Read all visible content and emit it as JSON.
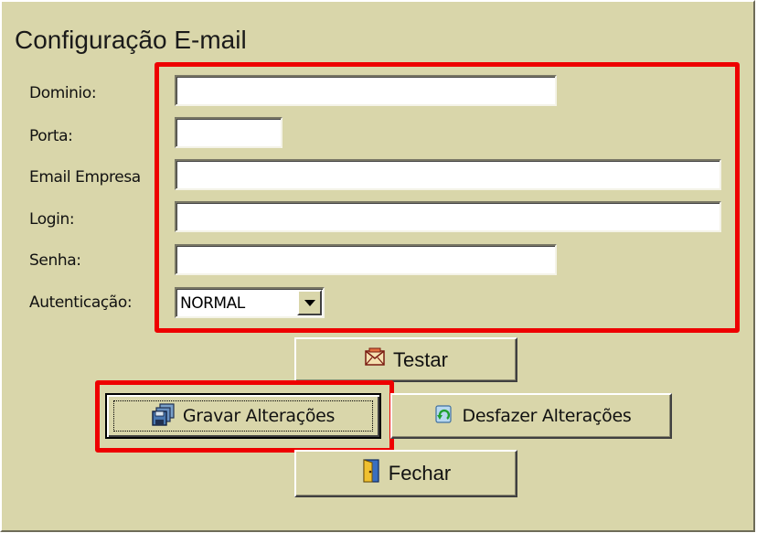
{
  "title": "Configuração E-mail",
  "fields": {
    "dominio": {
      "label": "Dominio:",
      "value": ""
    },
    "porta": {
      "label": "Porta:",
      "value": ""
    },
    "email_empresa": {
      "label": "Email Empresa",
      "value": ""
    },
    "login": {
      "label": "Login:",
      "value": ""
    },
    "senha": {
      "label": "Senha:",
      "value": ""
    },
    "autenticacao": {
      "label": "Autenticação:",
      "value": "NORMAL"
    }
  },
  "buttons": {
    "testar": "Testar",
    "gravar": "Gravar Alterações",
    "desfazer": "Desfazer Alterações",
    "fechar": "Fechar"
  },
  "colors": {
    "background": "#d9d6aa",
    "highlight": "#ee0000"
  },
  "icons": {
    "testar": "envelope-icon",
    "gravar": "save-disk-icon",
    "desfazer": "undo-recycle-icon",
    "fechar": "door-exit-icon"
  }
}
